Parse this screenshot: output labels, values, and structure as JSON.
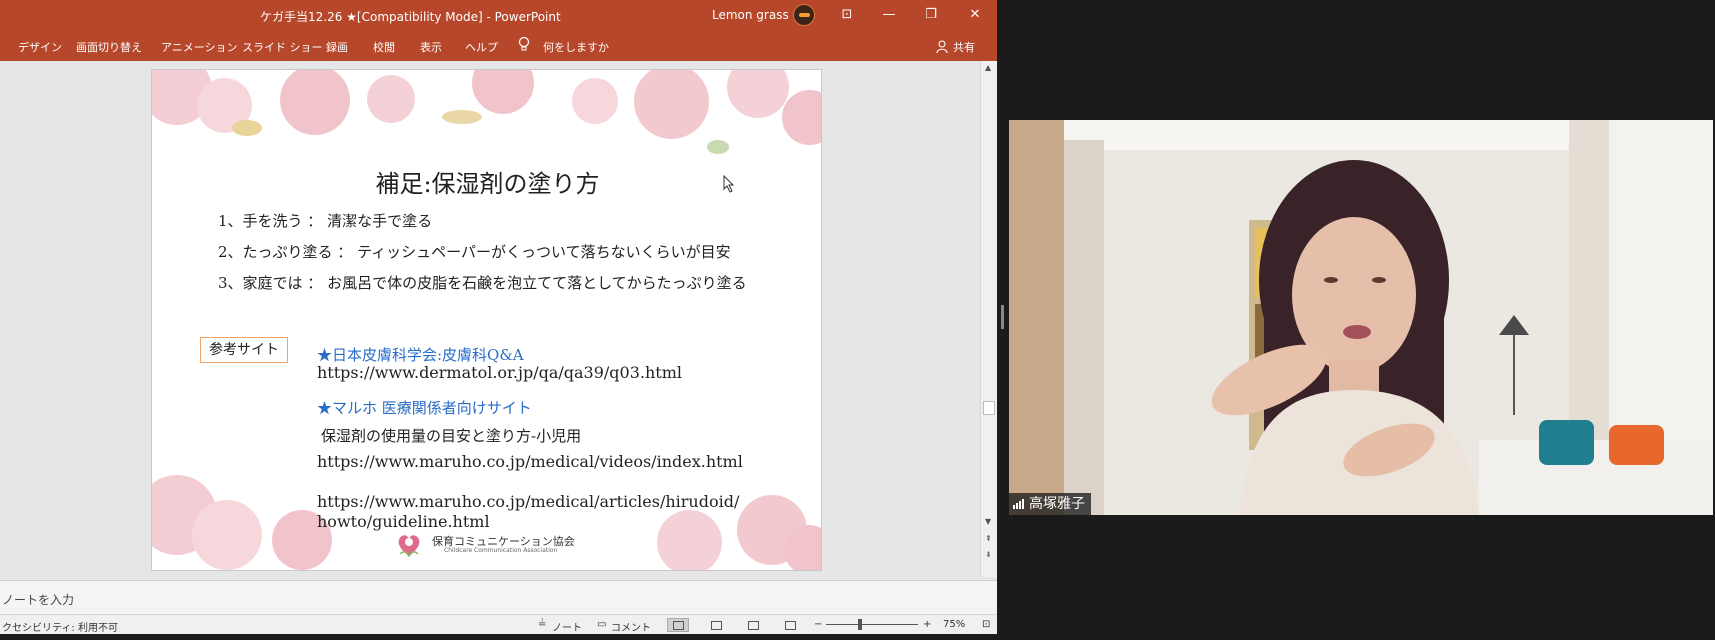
{
  "window": {
    "title": "ケガ手当12.26 ★[Compatibility Mode]  -  PowerPoint",
    "user_name": "Lemon grass",
    "controls": {
      "ribbon_display": "⊡",
      "minimize": "—",
      "maximize": "❐",
      "close": "✕"
    }
  },
  "ribbon": {
    "tabs": [
      "デザイン",
      "画面切り替え",
      "アニメーション",
      "スライド ショー",
      "録画",
      "校閲",
      "表示",
      "ヘルプ"
    ],
    "tell_me": "何をしますか",
    "share": "共有"
  },
  "slide": {
    "title": "補足:保湿剤の塗り方",
    "steps": [
      "1、手を洗う ： 清潔な手で塗る",
      "2、たっぷり塗る ： ティッシュペーパーがくっついて落ちないくらいが目安",
      "3、家庭では ： お風呂で体の皮脂を石鹸を泡立てて落としてからたっぷり塗る"
    ],
    "reference_label": "参考サイト",
    "links": [
      {
        "heading": "★日本皮膚科学会:皮膚科Q&A",
        "url": "https://www.dermatol.or.jp/qa/qa39/q03.html"
      },
      {
        "heading": "★マルホ 医療関係者向けサイト",
        "sub": "保湿剤の使用量の目安と塗り方-小児用",
        "url": "https://www.maruho.co.jp/medical/videos/index.html"
      }
    ],
    "url_long_line1": "https://www.maruho.co.jp/medical/articles/hirudoid/",
    "url_long_line2": "howto/guideline.html",
    "org_name": "保育コミュニケーション協会",
    "org_name_en": "Childcare Communication Association",
    "accent_color": "#2a6cc8",
    "rose_color": "#f2c9cf"
  },
  "notes": {
    "placeholder": "ノートを入力"
  },
  "status": {
    "accessibility": "クセシビリティ: 利用不可",
    "notes_btn": "ノート",
    "comments_btn": "コメント",
    "zoom_minus": "−",
    "zoom_plus": "+",
    "zoom": "75%"
  },
  "video": {
    "participant": "高塚雅子"
  }
}
